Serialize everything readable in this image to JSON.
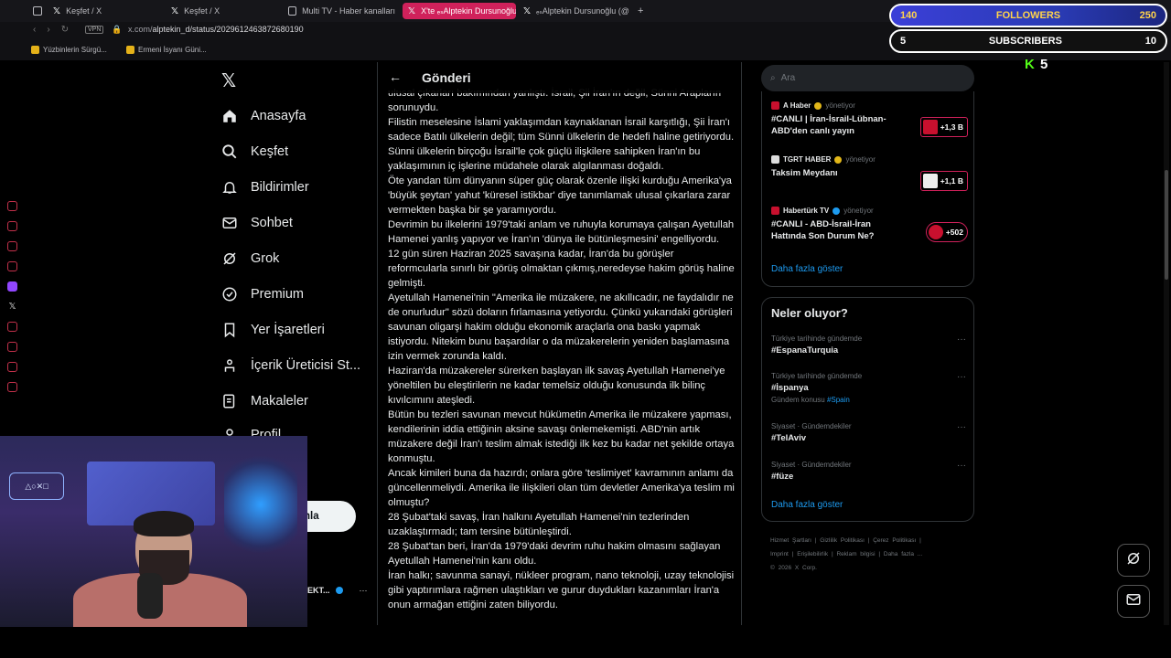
{
  "browser": {
    "tabs": [
      {
        "label": "Keşfet / X",
        "active": false
      },
      {
        "label": "Keşfet / X",
        "active": false
      },
      {
        "label": "Multi TV - Haber kanalları",
        "active": false
      },
      {
        "label": "X'te ₑₛAlptekin Dursunoğlu",
        "active": true
      },
      {
        "label": "ₑₛAlptekin Dursunoğlu (@a",
        "active": false
      }
    ],
    "new_tab": "+",
    "vpn_label": "VPN",
    "url_host": "x.com/",
    "url_path": "alptekin_d/status/2029612463872680190",
    "bookmarks": [
      "Yüzbinlerin Sürgü...",
      "Ermeni İsyanı Güni..."
    ]
  },
  "overlay": {
    "followers": {
      "current": "140",
      "label": "FOLLOWERS",
      "goal": "250"
    },
    "subscribers": {
      "current": "5",
      "label": "SUBSCRIBERS",
      "goal": "10"
    },
    "kick_count": "5"
  },
  "xnav": {
    "items": [
      "Anasayfa",
      "Keşfet",
      "Bildirimler",
      "Sohbet",
      "Grok",
      "Premium",
      "Yer İşaretleri",
      "İçerik Üreticisi St...",
      "Makaleler",
      "Profil"
    ],
    "post_button": "nla",
    "profile_name": "EKT..."
  },
  "main": {
    "back": "←",
    "title": "Gönderi",
    "paragraphs": [
      "ulusal çıkarları bakımından yanlıştı. İsrail, Şii İran'ın değil, Sünni Arapların sorunuydu.",
      "Filistin meselesine İslami yaklaşımdan kaynaklanan İsrail karşıtlığı, Şii İran'ı sadece Batılı ülkelerin değil; tüm Sünni ülkelerin de hedefi haline getiriyordu. Sünni ülkelerin birçoğu İsrail'le çok güçlü ilişkilere sahipken İran'ın bu yaklaşımının iç işlerine müdahele olarak algılanması doğaldı.",
      "Öte yandan tüm dünyanın süper güç olarak özenle ilişki kurduğu Amerika'ya 'büyük şeytan' yahut 'küresel istikbar' diye tanımlamak ulusal çıkarlara zarar vermekten başka bir şe yaramıyordu.",
      "Devrimin bu ilkelerini 1979'taki anlam ve ruhuyla korumaya çalışan Ayetullah Hamenei yanlış yapıyor ve İran'ın 'dünya ile bütünleşmesini' engelliyordu.",
      "12 gün süren Haziran 2025 savaşına kadar, İran'da bu görüşler reformcularla sınırlı bir görüş olmaktan çıkmış,neredeyse hakim görüş haline gelmişti.",
      "Ayetullah Hamenei'nin \"Amerika ile müzakere, ne akıllıcadır, ne faydalıdır ne de onurludur\" sözü doların fırlamasına yetiyordu. Çünkü yukarıdaki görüşleri savunan oligarşi hakim olduğu ekonomik araçlarla ona baskı yapmak istiyordu. Nitekim bunu başardılar o da müzakerelerin yeniden başlamasına izin vermek zorunda kaldı.",
      "Haziran'da müzakereler sürerken başlayan ilk savaş Ayetullah Hamenei'ye yöneltilen bu eleştirilerin ne kadar temelsiz olduğu konusunda ilk bilinç kıvılcımını ateşledi.",
      "Bütün bu tezleri savunan mevcut hükümetin Amerika ile müzakere yapması, kendilerinin iddia ettiğinin aksine savaşı önlemekemişti. ABD'nin artık müzakere değil İran'ı teslim almak istediği ilk kez bu kadar net şekilde ortaya konmuştu.",
      "Ancak kimileri buna da hazırdı; onlara göre 'teslimiyet' kavramının anlamı da güncellenmeliydi. Amerika ile ilişkileri olan tüm devletler Amerika'ya teslim mi olmuştu?",
      "28 Şubat'taki savaş, İran halkını Ayetullah Hamenei'nin tezlerinden uzaklaştırmadı; tam tersine bütünleştirdi.",
      "28 Şubat'tan beri, İran'da 1979'daki devrim ruhu hakim olmasını sağlayan Ayetullah Hamenei'nin kanı oldu.",
      "İran halkı; savunma sanayi, nükleer program, nano teknoloji, uzay teknolojisi gibi yaptırımlara rağmen ulaştıkları ve gurur duydukları kazanımları İran'a onun armağan ettiğini zaten biliyordu."
    ]
  },
  "right": {
    "search_placeholder": "Ara",
    "live": [
      {
        "source": "A Haber",
        "managed": "yönetiyor",
        "title": "#CANLI | İran-İsrail-Lübnan-ABD'den canlı yayın",
        "count": "+1,3 B"
      },
      {
        "source": "TGRT HABER",
        "managed": "yönetiyor",
        "title": "Taksim Meydanı",
        "count": "+1,1 B"
      },
      {
        "source": "Habertürk TV",
        "managed": "yönetiyor",
        "title": "#CANLI - ABD-İsrail-İran Hattında Son Durum Ne?",
        "count": "+502"
      }
    ],
    "show_more": "Daha fazla göster",
    "trends_title": "Neler oluyor?",
    "trends": [
      {
        "context": "Türkiye tarihinde gündemde",
        "tag": "#EspanaTurquia",
        "sub": "",
        "sub_link": ""
      },
      {
        "context": "Türkiye tarihinde gündemde",
        "tag": "#İspanya",
        "sub": "Gündem konusu",
        "sub_link": "#Spain"
      },
      {
        "context": "Siyaset · Gündemdekiler",
        "tag": "#TelAviv",
        "sub": "",
        "sub_link": ""
      },
      {
        "context": "Siyaset · Gündemdekiler",
        "tag": "#füze",
        "sub": "",
        "sub_link": ""
      }
    ],
    "trends_more": "Daha fazla göster",
    "footer": [
      "Hizmet Şartları",
      "Gizlilik Politikası",
      "Çerez Politikası",
      "Imprint",
      "Erişilebilirlik",
      "Reklam bilgisi",
      "Daha fazla ...",
      "© 2026 X Corp."
    ]
  }
}
